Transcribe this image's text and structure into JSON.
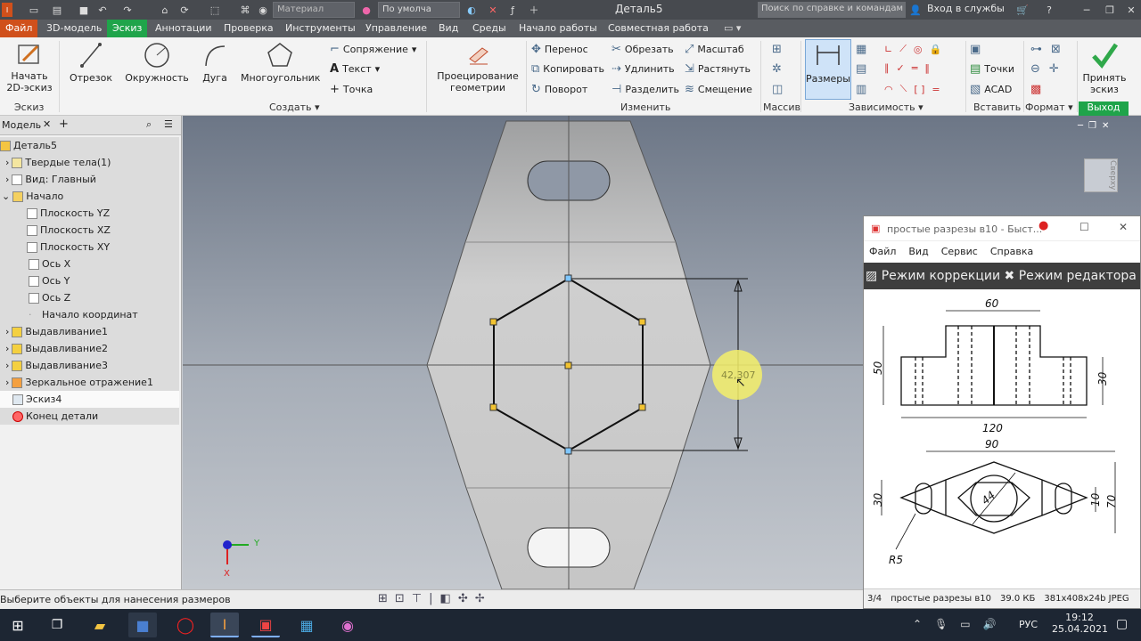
{
  "app": {
    "window_title": "Деталь5",
    "style_combo": "По умолча",
    "material_combo": "Материал",
    "search_placeholder": "Поиск по справке и командам",
    "login": "Вход в службы"
  },
  "tabs": [
    {
      "label": "Файл"
    },
    {
      "label": "3D-модель"
    },
    {
      "label": "Эскиз"
    },
    {
      "label": "Аннотации"
    },
    {
      "label": "Проверка"
    },
    {
      "label": "Инструменты"
    },
    {
      "label": "Управление"
    },
    {
      "label": "Вид"
    },
    {
      "label": "Среды"
    },
    {
      "label": "Начало работы"
    },
    {
      "label": "Совместная работа"
    }
  ],
  "ribbon": {
    "sketch": {
      "start": "Начать 2D-эскиз",
      "group": "Эскиз"
    },
    "create": {
      "line": "Отрезок",
      "circle": "Окружность",
      "arc": "Дуга",
      "polygon": "Многоугольник",
      "fillet": "Сопряжение",
      "text": "Текст",
      "point": "Точка",
      "group": "Создать"
    },
    "project": "Проецирование геометрии",
    "modify": {
      "move": "Перенос",
      "copy": "Копировать",
      "rotate": "Поворот",
      "trim": "Обрезать",
      "extend": "Удлинить",
      "split": "Разделить",
      "scale": "Масштаб",
      "stretch": "Растянуть",
      "offset": "Смещение",
      "group": "Изменить"
    },
    "pattern": {
      "group": "Массив"
    },
    "dimension": {
      "label": "Размеры"
    },
    "constrain": {
      "group": "Зависимость"
    },
    "insert": {
      "points": "Точки",
      "acad": "ACAD",
      "group": "Вставить"
    },
    "format": {
      "group": "Формат"
    },
    "exit": {
      "accept": "Принять эскиз",
      "group": "Выход"
    }
  },
  "browser": {
    "tab": "Модель",
    "items": [
      {
        "label": "Деталь5"
      },
      {
        "label": "Твердые тела(1)"
      },
      {
        "label": "Вид: Главный"
      },
      {
        "label": "Начало"
      },
      {
        "label": "Плоскость YZ"
      },
      {
        "label": "Плоскость XZ"
      },
      {
        "label": "Плоскость XY"
      },
      {
        "label": "Ось X"
      },
      {
        "label": "Ось Y"
      },
      {
        "label": "Ось Z"
      },
      {
        "label": "Начало координат"
      },
      {
        "label": "Выдавливание1"
      },
      {
        "label": "Выдавливание2"
      },
      {
        "label": "Выдавливание3"
      },
      {
        "label": "Зеркальное отражение1"
      },
      {
        "label": "Эскиз4"
      },
      {
        "label": "Конец детали"
      }
    ]
  },
  "viewport": {
    "dimension_value": "42,307",
    "view_cube": "Сверху",
    "axis_y": "Y",
    "axis_x": "X"
  },
  "status": {
    "prompt": "Выберите объекты для нанесения размеров"
  },
  "photo_viewer": {
    "title": "простые разрезы в10 - Быст...",
    "menu": [
      "Файл",
      "Вид",
      "Сервис",
      "Справка"
    ],
    "mode_correct": "Режим коррекции",
    "mode_edit": "Режим редактора",
    "drawing": {
      "d60": "60",
      "d50": "50",
      "d30": "30",
      "d120": "120",
      "d90": "90",
      "d30b": "30",
      "d10": "10",
      "d70": "70",
      "d44": "44",
      "r5": "R5"
    },
    "status": {
      "index": "3/4",
      "name": "простые разрезы в10",
      "size": "39.0 КБ",
      "format": "381x408x24b JPEG"
    }
  },
  "taskbar": {
    "lang": "РУС",
    "time": "19:12",
    "date": "25.04.2021"
  }
}
